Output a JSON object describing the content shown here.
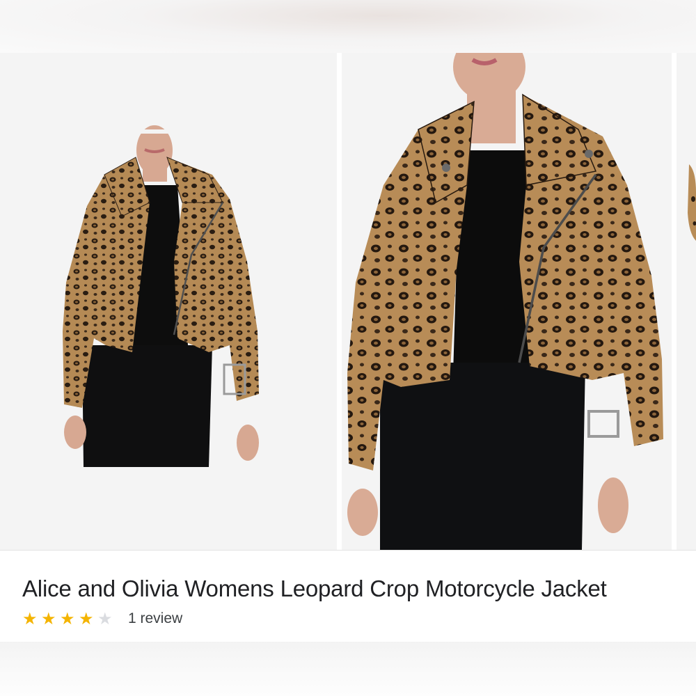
{
  "product": {
    "title": "Alice and Olivia Womens Leopard Crop Motorcycle Jacket",
    "rating": 4,
    "rating_max": 5,
    "review_text": "1 review"
  },
  "gallery": {
    "images": [
      {
        "icon": "jacket-photo-front-icon"
      },
      {
        "icon": "jacket-photo-closeup-icon"
      },
      {
        "icon": "jacket-photo-partial-icon"
      }
    ]
  },
  "colors": {
    "star_filled": "#f4b400",
    "star_empty": "#dadce0",
    "title_text": "#202124"
  }
}
